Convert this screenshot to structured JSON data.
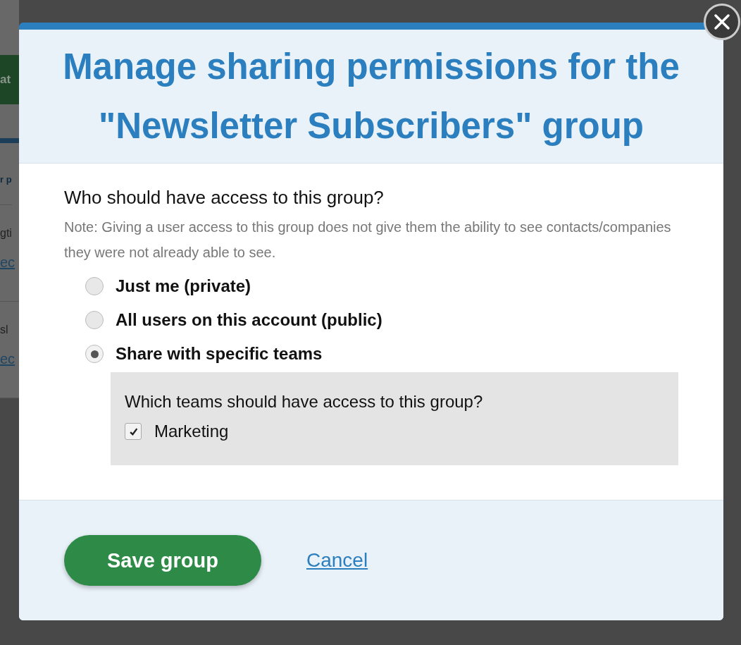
{
  "background": {
    "button": "at",
    "heading": "r p",
    "rows": [
      {
        "title": "gti",
        "link": "ec"
      },
      {
        "title": "sl",
        "link": "ec"
      }
    ]
  },
  "dialog": {
    "title": "Manage sharing permissions for the \"Newsletter Subscribers\" group",
    "question": "Who should have access to this group?",
    "note": "Note: Giving a user access to this group does not give them the ability to see contacts/companies they were not already able to see.",
    "options": [
      {
        "label": "Just me (private)",
        "selected": false
      },
      {
        "label": "All users on this account (public)",
        "selected": false
      },
      {
        "label": "Share with specific teams",
        "selected": true
      }
    ],
    "teams": {
      "question": "Which teams should have access to this group?",
      "items": [
        {
          "label": "Marketing",
          "checked": true
        }
      ]
    },
    "save_button": "Save group",
    "cancel_link": "Cancel"
  }
}
